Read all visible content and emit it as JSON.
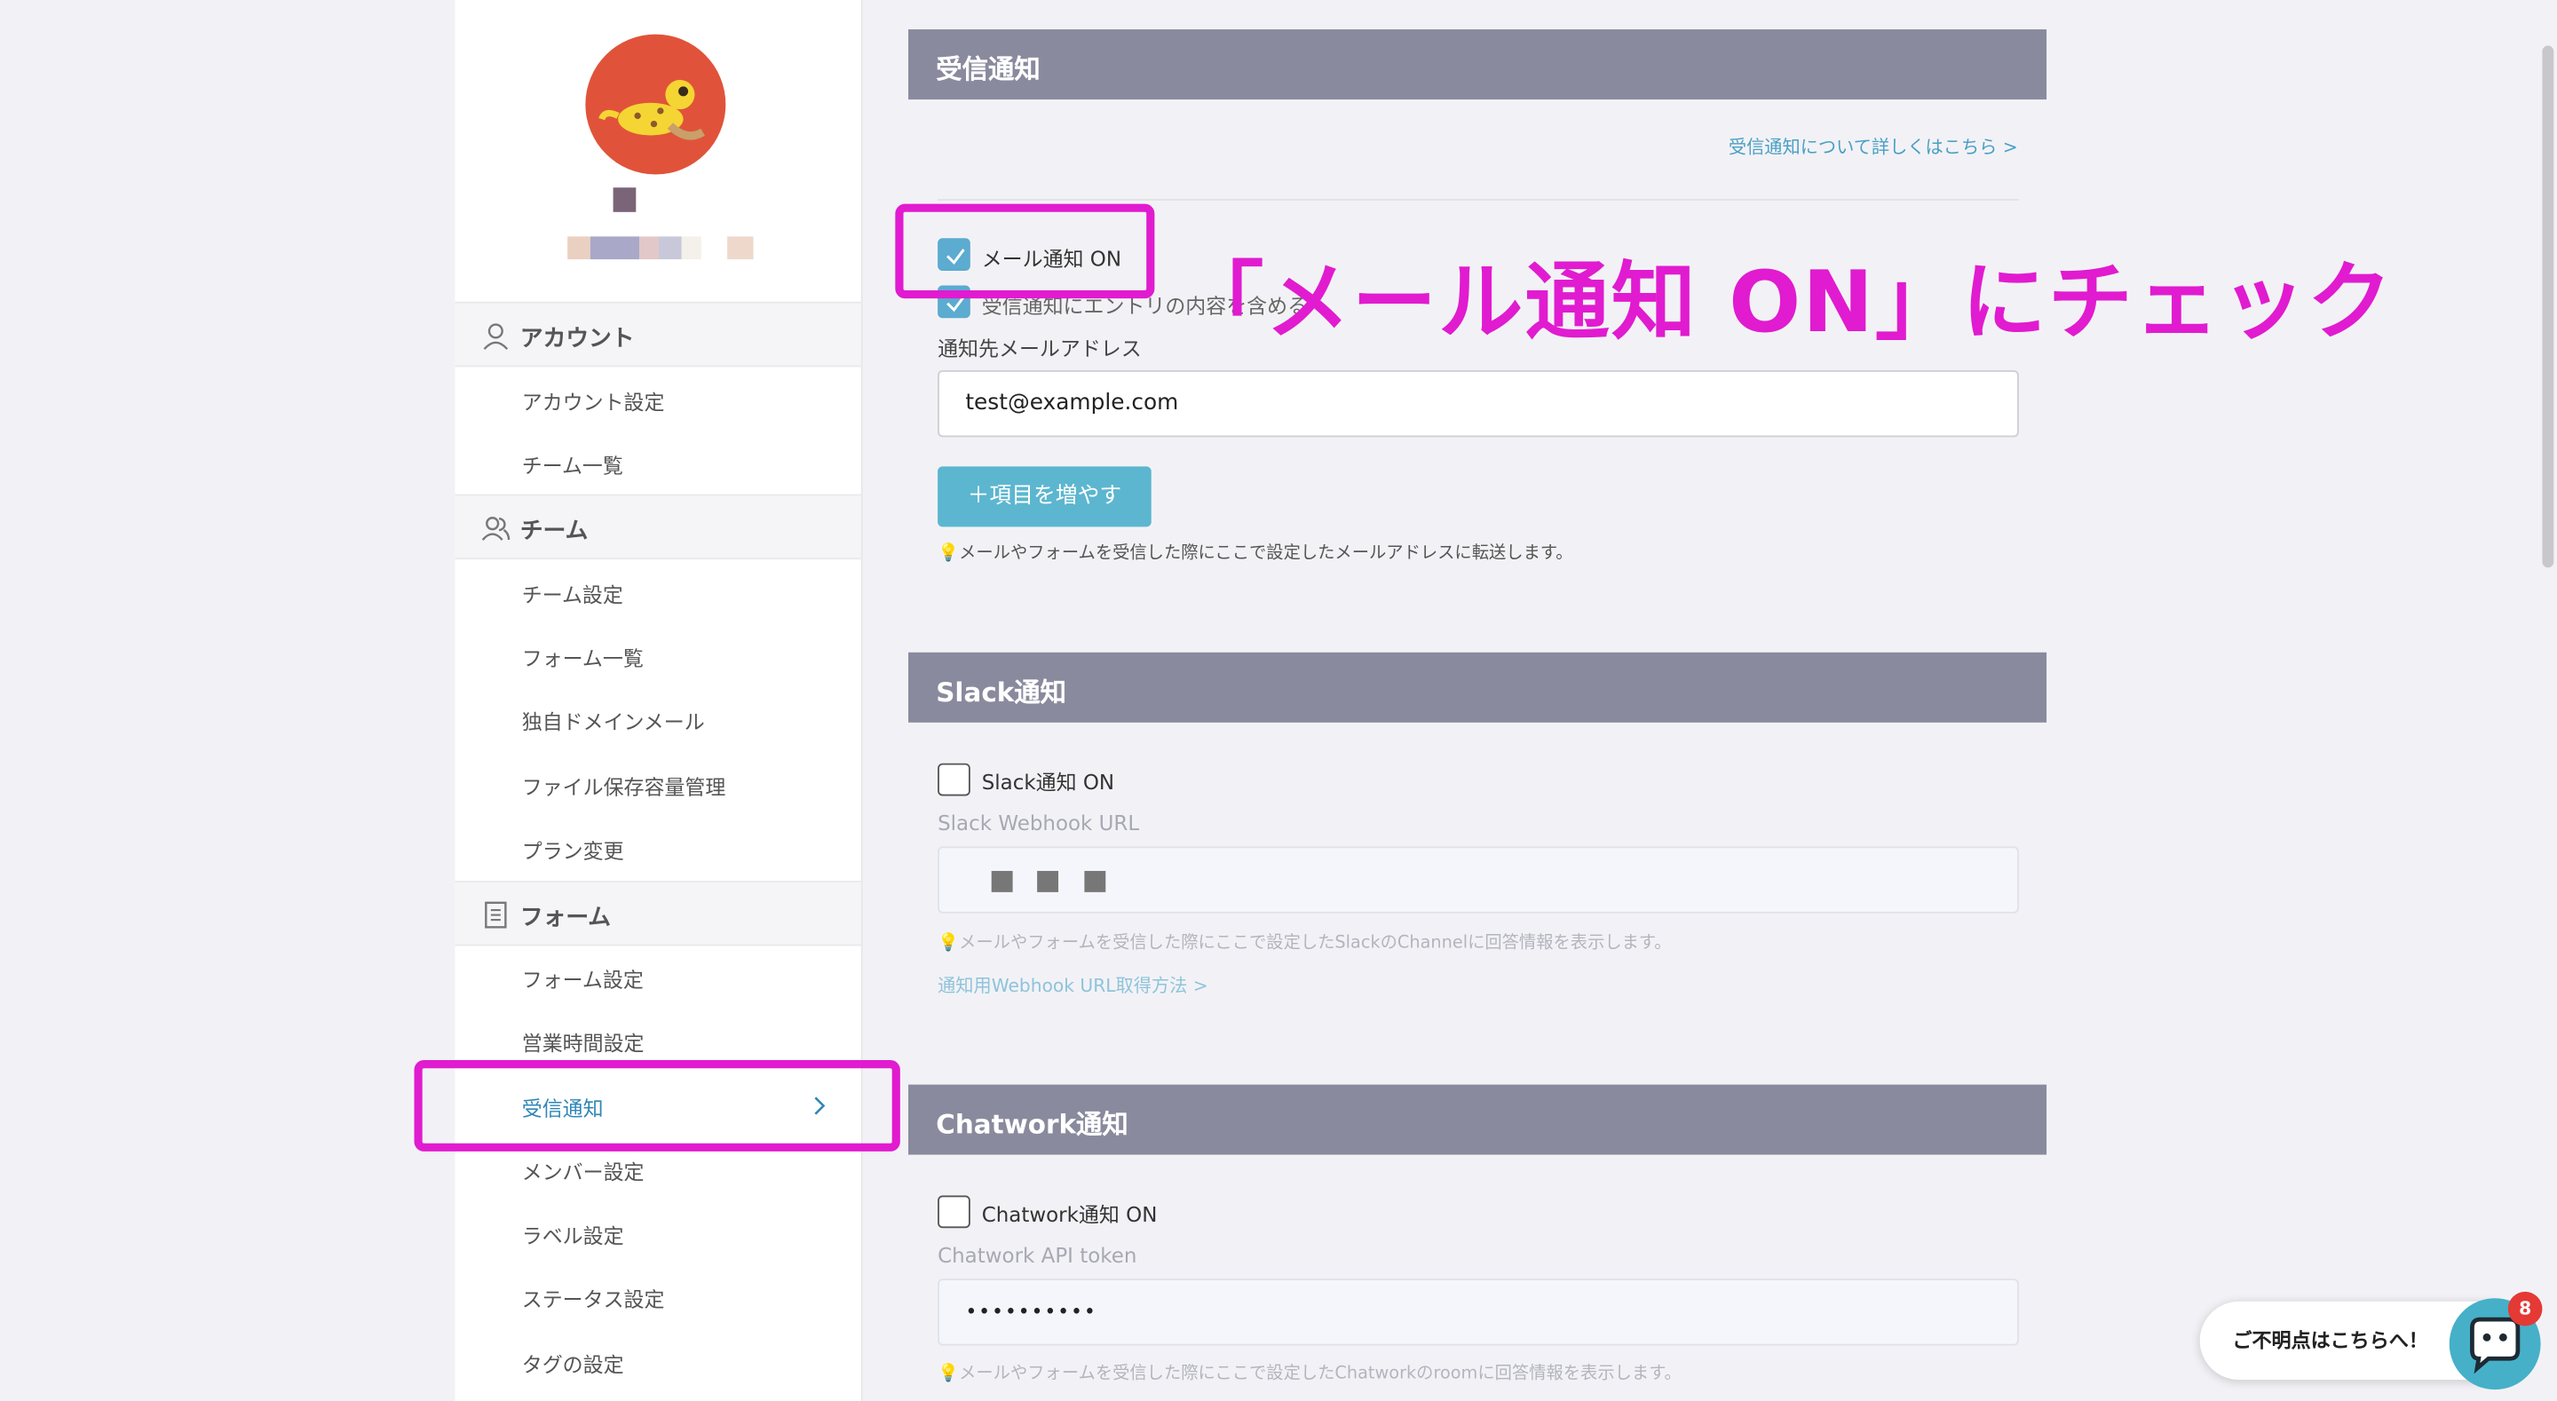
{
  "sidebar": {
    "sections": [
      {
        "label": "アカウント",
        "icon": "user-icon",
        "items": [
          "アカウント設定",
          "チーム一覧"
        ]
      },
      {
        "label": "チーム",
        "icon": "users-icon",
        "items": [
          "チーム設定",
          "フォーム一覧",
          "独自ドメインメール",
          "ファイル保存容量管理",
          "プラン変更"
        ]
      },
      {
        "label": "フォーム",
        "icon": "document-icon",
        "items": [
          "フォーム設定",
          "営業時間設定",
          "受信通知",
          "メンバー設定",
          "ラベル設定",
          "ステータス設定",
          "タグの設定"
        ]
      }
    ],
    "active_item": "受信通知"
  },
  "email_panel": {
    "title": "受信通知",
    "help_link": "受信通知について詳しくはこちら >",
    "mail_on_label": "メール通知 ON",
    "include_entry_label": "受信通知にエントリの内容を含める",
    "address_label": "通知先メールアドレス",
    "address_value": "test@example.com",
    "add_button": "＋項目を増やす",
    "hint": "💡メールやフォームを受信した際にここで設定したメールアドレスに転送します。"
  },
  "slack_panel": {
    "title": "Slack通知",
    "on_label": "Slack通知 ON",
    "url_label": "Slack Webhook URL",
    "hint": "💡メールやフォームを受信した際にここで設定したSlackのChannelに回答情報を表示します。",
    "howto_link": "通知用Webhook URL取得方法 >"
  },
  "chatwork_panel": {
    "title": "Chatwork通知",
    "on_label": "Chatwork通知 ON",
    "token_label": "Chatwork API token",
    "token_value": "••••••••••",
    "hint": "💡メールやフォームを受信した際にここで設定したChatworkのroomに回答情報を表示します。"
  },
  "annotation": "「メール通知 ON」にチェック",
  "help_widget": {
    "label": "ご不明点はこちらへ！",
    "badge": "8"
  },
  "colors": {
    "highlight": "#e11bd0",
    "panel_header": "#8a8a9e",
    "accent": "#5cb6cf",
    "avatar": "#e0533a"
  }
}
